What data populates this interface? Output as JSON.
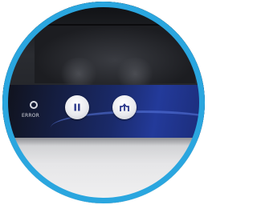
{
  "panel": {
    "error_label": "ERROR",
    "buttons": [
      {
        "icon": "pause-icon"
      },
      {
        "icon": "eject-icon"
      }
    ]
  },
  "colors": {
    "lens_border": "#2aa6df",
    "panel_blue": "#233a9a",
    "device_dark": "#1a1b1f"
  }
}
